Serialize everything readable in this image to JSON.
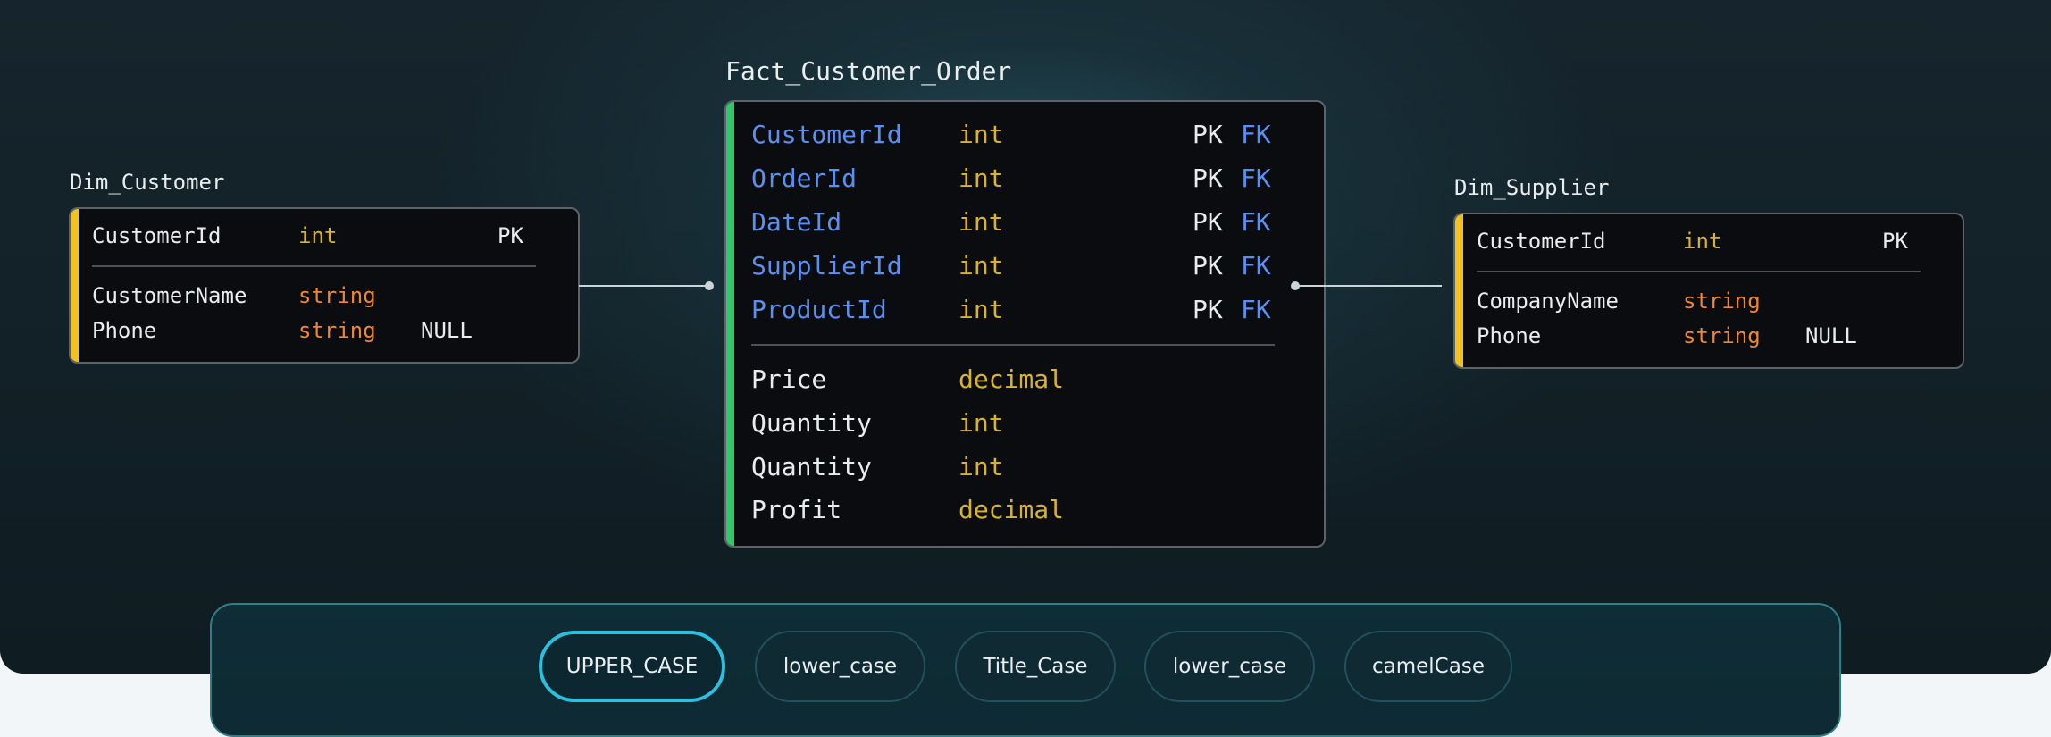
{
  "tables": {
    "dim_customer": {
      "title": "Dim_Customer",
      "accent_color": "#f4c21d",
      "key_fields": [
        {
          "name": "CustomerId",
          "type": "int",
          "pk": "PK"
        }
      ],
      "fields": [
        {
          "name": "CustomerName",
          "type": "string",
          "null": ""
        },
        {
          "name": "Phone",
          "type": "string",
          "null": "NULL"
        }
      ]
    },
    "fact": {
      "title": "Fact_Customer_Order",
      "accent_color": "#34c76a",
      "key_fields": [
        {
          "name": "CustomerId",
          "type": "int",
          "pk": "PK",
          "fk": "FK"
        },
        {
          "name": "OrderId",
          "type": "int",
          "pk": "PK",
          "fk": "FK"
        },
        {
          "name": "DateId",
          "type": "int",
          "pk": "PK",
          "fk": "FK"
        },
        {
          "name": "SupplierId",
          "type": "int",
          "pk": "PK",
          "fk": "FK"
        },
        {
          "name": "ProductId",
          "type": "int",
          "pk": "PK",
          "fk": "FK"
        }
      ],
      "fields": [
        {
          "name": "Price",
          "type": "decimal"
        },
        {
          "name": "Quantity",
          "type": "int"
        },
        {
          "name": "Quantity",
          "type": "int"
        },
        {
          "name": "Profit",
          "type": "decimal"
        }
      ]
    },
    "dim_supplier": {
      "title": "Dim_Supplier",
      "accent_color": "#f4c21d",
      "key_fields": [
        {
          "name": "CustomerId",
          "type": "int",
          "pk": "PK"
        }
      ],
      "fields": [
        {
          "name": "CompanyName",
          "type": "string",
          "null": ""
        },
        {
          "name": "Phone",
          "type": "string",
          "null": "NULL"
        }
      ]
    }
  },
  "case_options": {
    "selected": "UPPER_CASE",
    "items": [
      "UPPER_CASE",
      "lower_case",
      "Title_Case",
      "lower_case",
      "camelCase"
    ]
  },
  "colors": {
    "key_column": "#5b8ff0",
    "type_numeric": "#d9b32a",
    "type_string": "#f0862f",
    "active_option_border": "#2bbfe0"
  }
}
